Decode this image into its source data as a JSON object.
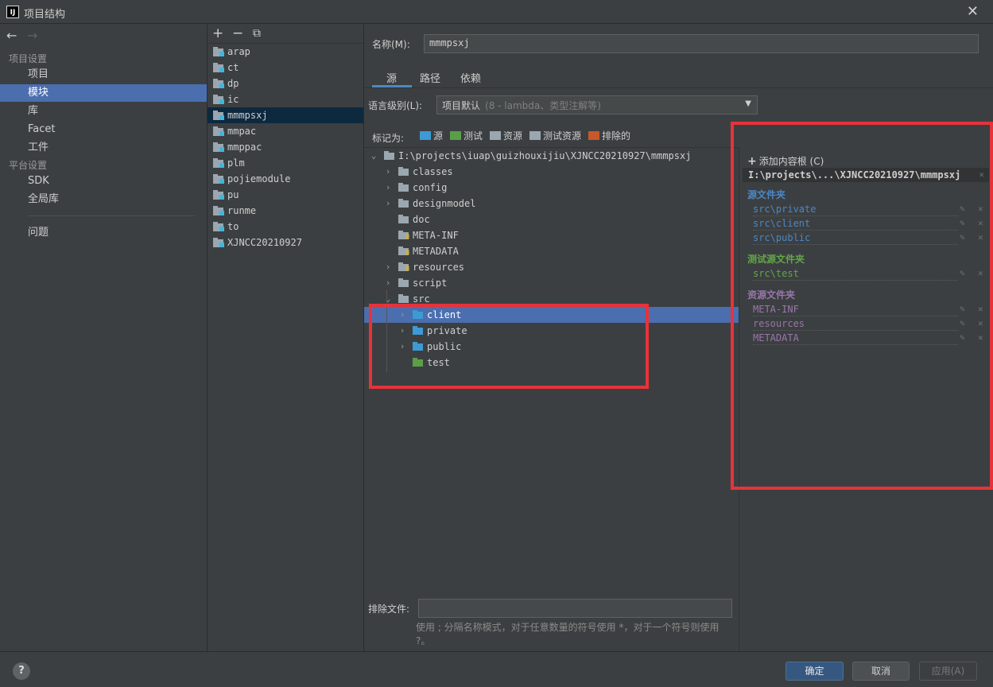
{
  "window": {
    "title": "项目结构",
    "logo": "IJ"
  },
  "nav": {
    "back_icon": "←",
    "forward_icon": "→",
    "section_project": "项目设置",
    "section_platform": "平台设置",
    "items": [
      {
        "label": "项目"
      },
      {
        "label": "模块"
      },
      {
        "label": "库"
      },
      {
        "label": "Facet"
      },
      {
        "label": "工件"
      },
      {
        "label": "SDK"
      },
      {
        "label": "全局库"
      },
      {
        "label": "问题"
      }
    ],
    "selected": "模块"
  },
  "modules": {
    "toolbar": {
      "add": "+",
      "remove": "−",
      "copy": "⧉"
    },
    "items": [
      "arap",
      "ct",
      "dp",
      "ic",
      "mmmpsxj",
      "mmpac",
      "mmppac",
      "plm",
      "pojiemodule",
      "pu",
      "runme",
      "to",
      "XJNCC20210927"
    ],
    "selected": "mmmpsxj"
  },
  "main": {
    "name_label": "名称(M):",
    "name_value": "mmmpsxj",
    "tabs": [
      "源",
      "路径",
      "依赖"
    ],
    "active_tab": "源",
    "lang_label": "语言级别(L):",
    "lang_value": "项目默认",
    "lang_hint": "(8 - lambda、类型注解等)",
    "mark_as_label": "标记为:",
    "mark_as": [
      "源",
      "测试",
      "资源",
      "测试资源",
      "排除的"
    ],
    "tree": {
      "root": "I:\\projects\\iuap\\guizhouxijiu\\XJNCC20210927\\mmmpsxj",
      "folders": [
        "classes",
        "config",
        "designmodel",
        "doc",
        "META-INF",
        "METADATA",
        "resources",
        "script",
        "src"
      ],
      "src_children": [
        "client",
        "private",
        "public",
        "test"
      ],
      "selected": "client"
    },
    "exclude_label": "排除文件:",
    "exclude_value": "",
    "exclude_hint": "使用 ; 分隔名称模式，对于任意数量的符号使用 *，对于一个符号则使用 ?。"
  },
  "content_root": {
    "add_label": "添加内容根 (C)",
    "path": "I:\\projects\\...\\XJNCC20210927\\mmmpsxj",
    "groups": [
      {
        "title": "源文件夹",
        "color": "#4a88c7",
        "items": [
          "src\\private",
          "src\\client",
          "src\\public"
        ]
      },
      {
        "title": "测试源文件夹",
        "color": "#62a64a",
        "items": [
          "src\\test"
        ]
      },
      {
        "title": "资源文件夹",
        "color": "#9876aa",
        "items": [
          "META-INF",
          "resources",
          "METADATA"
        ]
      }
    ]
  },
  "footer": {
    "help": "?",
    "ok": "确定",
    "cancel": "取消",
    "apply": "应用(A)"
  },
  "colors": {
    "accent_selection": "#4b6eaf",
    "highlight_red": "#e8323a",
    "source_blue": "#4a88c7",
    "test_green": "#62a64a",
    "resource_purple": "#9876aa",
    "excluded_orange": "#c8582a"
  }
}
